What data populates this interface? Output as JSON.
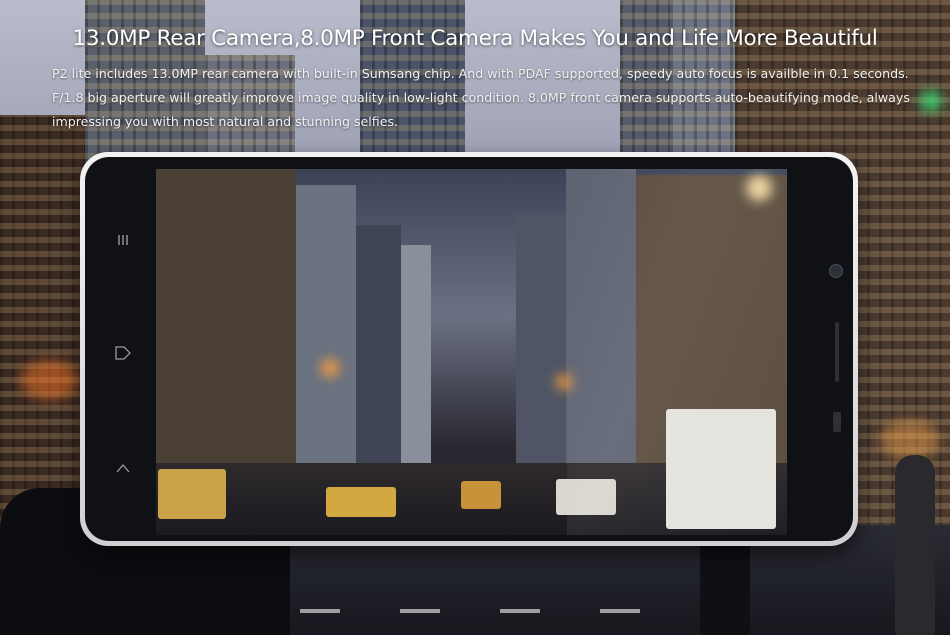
{
  "headline": "13.0MP Rear Camera,8.0MP Front Camera Makes You and Life More Beautiful",
  "description": "P2 lite includes 13.0MP rear camera with built-in Sumsang chip. And with PDAF supported, speedy auto focus is availble in 0.1 seconds. F/1.8 big aperture will greatly improve image quality in low-light condition. 8.0MP front camera supports auto-beautifying mode, always impressing you with most natural and stunning selfies.",
  "phone": {
    "nav_buttons": [
      "menu-icon",
      "back-icon",
      "home-icon"
    ],
    "screen_content": "city-street-night-photo"
  },
  "colors": {
    "headline_text": "#ffffff",
    "phone_frame": "#e6e6e8",
    "phone_body": "#101114"
  }
}
